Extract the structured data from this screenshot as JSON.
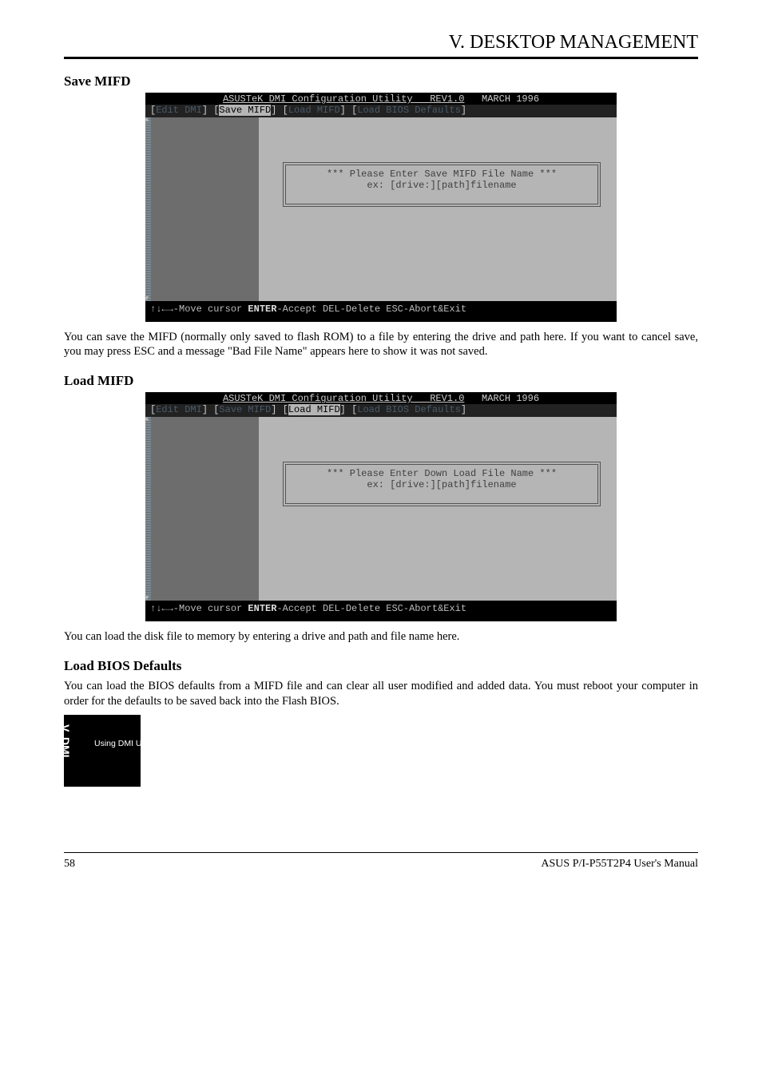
{
  "header": {
    "title": "V. DESKTOP MANAGEMENT"
  },
  "sections": {
    "save": {
      "title": "Save MIFD",
      "body": "You can save the MIFD (normally only saved to flash ROM) to a file by entering the drive and path here.  If you want to cancel save, you may press ESC and a message \"Bad File Name\" appears here to show it was not saved."
    },
    "load": {
      "title": "Load MIFD",
      "body": "You can load the disk file to memory by entering a drive and path and file name here."
    },
    "bios": {
      "title": "Load BIOS Defaults",
      "body1": "You can load the BIOS defaults from a MIFD file and can clear all user modified and added data.  You must reboot your computer in order for the defaults to be saved back into the Flash BIOS."
    }
  },
  "dmi": {
    "title_underline": "ASUSTeK DMI Configuration Utility   REV1.0",
    "title_tail": "   MARCH 1996",
    "menu": {
      "items": [
        "Edit DMI",
        "Save MIFD",
        "Load MIFD",
        "Load BIOS Defaults"
      ]
    },
    "dialog_save": {
      "line1": "*** Please Enter Save MIFD File Name ***",
      "line2": "ex: [drive:][path]filename"
    },
    "dialog_load": {
      "line1": "*** Please Enter Down Load File Name ***",
      "line2": "ex: [drive:][path]filename"
    },
    "footer": "↑↓←→-Move cursor ENTER-Accept DEL-Delete ESC-Abort&Exit"
  },
  "sidetab": {
    "vert": "V. DMI",
    "sub": "Using DMI Utility"
  },
  "footer": {
    "page": "58",
    "manual": "ASUS P/I-P55T2P4 User's Manual"
  }
}
